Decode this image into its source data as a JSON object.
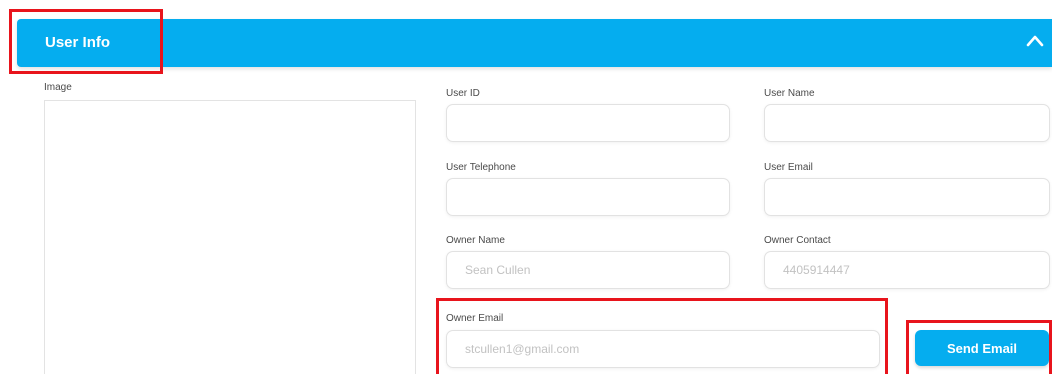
{
  "header": {
    "title": "User Info",
    "collapse_icon": "chevron-up-icon",
    "color": "#05adef"
  },
  "image_field": {
    "label": "Image"
  },
  "fields": {
    "user_id": {
      "label": "User ID",
      "value": "",
      "placeholder": ""
    },
    "user_name": {
      "label": "User Name",
      "value": "",
      "placeholder": ""
    },
    "user_telephone": {
      "label": "User Telephone",
      "value": "",
      "placeholder": ""
    },
    "user_email": {
      "label": "User Email",
      "value": "",
      "placeholder": ""
    },
    "owner_name": {
      "label": "Owner Name",
      "value": "",
      "placeholder": "Sean Cullen"
    },
    "owner_contact": {
      "label": "Owner Contact",
      "value": "",
      "placeholder": "4405914447"
    },
    "owner_email": {
      "label": "Owner Email",
      "value": "",
      "placeholder": "stcullen1@gmail.com"
    }
  },
  "actions": {
    "send_email_label": "Send Email"
  },
  "annotation_color": "#e8141c"
}
